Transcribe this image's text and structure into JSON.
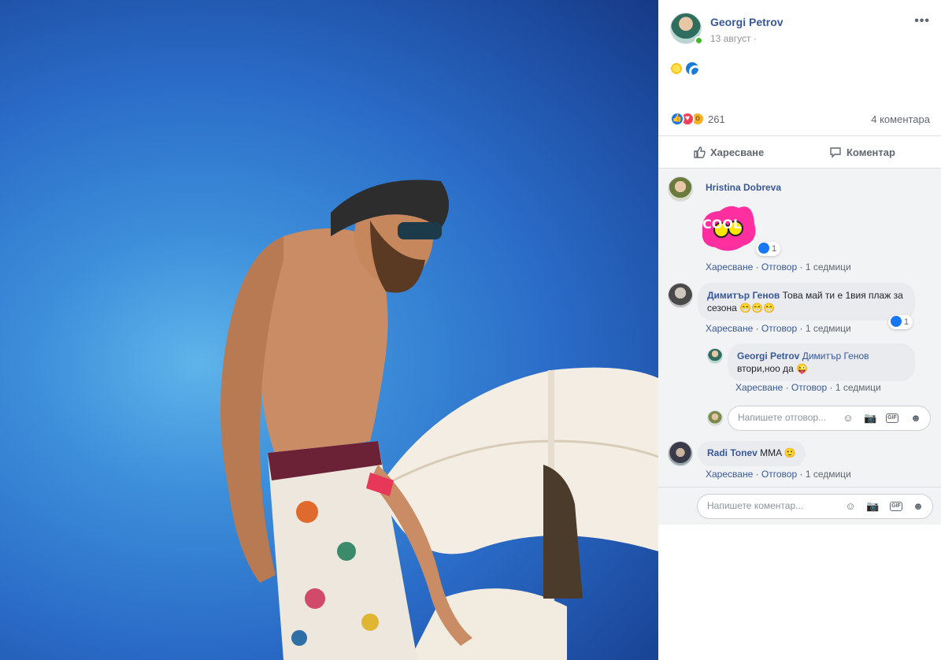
{
  "post": {
    "author": "Georgi Petrov",
    "date": "13 август",
    "date_suffix": "·",
    "more": "•••",
    "text_emojis": [
      "sun-emoji",
      "wave-emoji"
    ],
    "reactions": {
      "types": [
        "like",
        "love",
        "wow"
      ],
      "count": "261"
    },
    "comment_count": "4 коментара"
  },
  "actions": {
    "like_label": "Харесване",
    "comment_label": "Коментар"
  },
  "comments": [
    {
      "author": "Hristina Dobreva",
      "sticker": "COOL",
      "reactions": "1",
      "like": "Харесване",
      "reply": "Отговор",
      "time": "1 седмици"
    },
    {
      "author": "Димитър Генов",
      "text": "Това май ти е 1вия плаж за сезона",
      "reactions": "1",
      "like": "Харесване",
      "reply": "Отговор",
      "time": "1 седмици",
      "replies": [
        {
          "author": "Georgi Petrov",
          "mention": "Димитър Генов",
          "text": "втори,ноо да",
          "like": "Харесване",
          "reply": "Отговор",
          "time": "1 седмици"
        }
      ]
    },
    {
      "author": "Radi Tonev",
      "text": "MMA",
      "like": "Харесване",
      "reply": "Отговор",
      "time": "1 седмици"
    }
  ],
  "reply_input": {
    "placeholder": "Напишете отговор..."
  },
  "comment_input": {
    "placeholder": "Напишете коментар..."
  },
  "colors": {
    "link": "#385898",
    "like_blue": "#1877f2",
    "sky": "#2a6cc8"
  }
}
